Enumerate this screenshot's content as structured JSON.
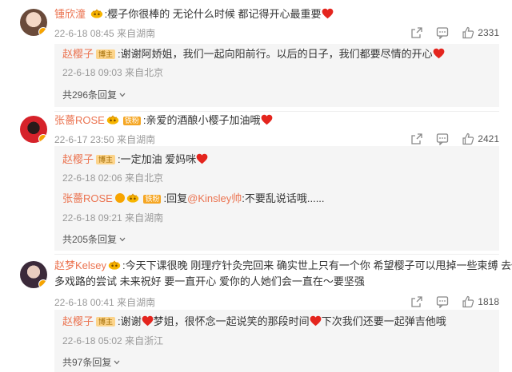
{
  "comments": [
    {
      "user": "锺欣潼",
      "text": "樱子你很棒的 无论什么时候 都记得开心最重要",
      "time": "22-6-18 08:45",
      "location": "来自湖南",
      "likes": "2331",
      "reply": {
        "user": "赵樱子",
        "role": "博主",
        "text": "谢谢阿娇姐，我们一起向阳前行。以后的日子，我们都要尽情的开心",
        "time": "22-6-18 09:03",
        "location": "来自北京"
      },
      "more": "共296条回复"
    },
    {
      "user": "张薔ROSE",
      "vip_tag": "铁粉",
      "text": "亲爱的酒酿小樱子加油哦",
      "time": "22-6-17 23:50",
      "location": "来自湖南",
      "likes": "2421",
      "replies": [
        {
          "user": "赵樱子",
          "role": "博主",
          "text": "一定加油  爱妈咪",
          "time": "22-6-18 02:06",
          "location": "来自北京"
        },
        {
          "user": "张薔ROSE",
          "vip_tag": "铁粉",
          "prefix": "回复",
          "mention": "@Kinsley帅",
          "text": "不要乱说话哦......",
          "time": "22-6-18 09:21",
          "location": "来自湖南"
        }
      ],
      "more": "共205条回复"
    },
    {
      "user": "赵梦Kelsey",
      "text_line1": "今天下课很晚 刚理疗针灸完回来 确实世上只有一个你 希望樱子可以甩掉一些束缚 去做更",
      "text_line2": "多戏路的尝试 未来祝好 要一直开心 爱你的人她们会一直在～要坚强",
      "time": "22-6-18 00:41",
      "location": "来自湖南",
      "likes": "1818",
      "reply": {
        "user": "赵樱子",
        "role": "博主",
        "text_a": "谢谢",
        "text_b": "梦姐，很怀念一起说笑的那段时间",
        "text_c": "下次我们还要一起弹吉他哦",
        "time": "22-6-18 05:02",
        "location": "来自浙江"
      },
      "more": "共97条回复"
    }
  ],
  "colors": {
    "accent": "#eb7350",
    "heart": "#e4251e",
    "meta": "#999999",
    "reply_bg": "#f5f5f5"
  }
}
